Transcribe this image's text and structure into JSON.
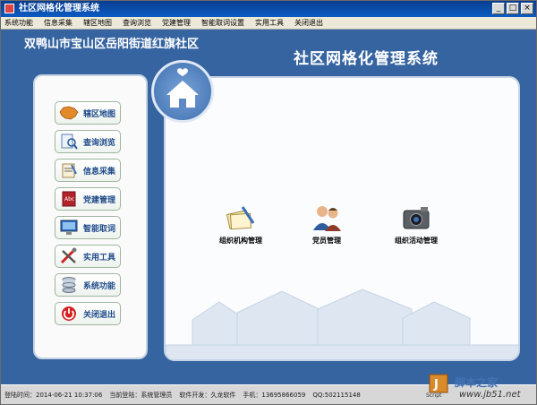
{
  "window": {
    "title": "社区网格化管理系统",
    "controls": [
      "_",
      "□",
      "×"
    ]
  },
  "menu": {
    "items": [
      "系统功能",
      "信息采集",
      "辖区地图",
      "查询浏览",
      "党建管理",
      "智能取词设置",
      "实用工具",
      "关闭退出"
    ]
  },
  "header": {
    "community": "双鸭山市宝山区岳阳街道红旗社区",
    "system_title": "社区网格化管理系统"
  },
  "sidebar": {
    "items": [
      {
        "label": "辖区地图",
        "icon": "china-map-icon"
      },
      {
        "label": "查询浏览",
        "icon": "search-document-icon"
      },
      {
        "label": "信息采集",
        "icon": "clipboard-icon"
      },
      {
        "label": "党建管理",
        "icon": "book-icon"
      },
      {
        "label": "智能取词",
        "icon": "monitor-icon"
      },
      {
        "label": "实用工具",
        "icon": "tools-icon"
      },
      {
        "label": "系统功能",
        "icon": "database-icon"
      },
      {
        "label": "关闭退出",
        "icon": "power-icon"
      }
    ]
  },
  "modules": [
    {
      "label": "组织机构管理",
      "icon": "documents-pen-icon"
    },
    {
      "label": "党员管理",
      "icon": "people-icon"
    },
    {
      "label": "组织活动管理",
      "icon": "camera-icon"
    }
  ],
  "statusbar": {
    "login_time_label": "登陆时间：",
    "login_time_value": "2014-06-21 10:37:06",
    "current_user_label": "当前登陆：",
    "current_user_value": "系统管理员",
    "developer": "软件开发：久龙软件",
    "phone": "手机：13695866059",
    "qq": "QQ:502115148"
  },
  "watermark": {
    "text": "脚本之家",
    "url": "www.jb51.net",
    "script_label": "Script"
  },
  "colors": {
    "background": "#3564a0",
    "title_bar": "#0b5bc4",
    "nav_label": "#1e4a8a"
  }
}
